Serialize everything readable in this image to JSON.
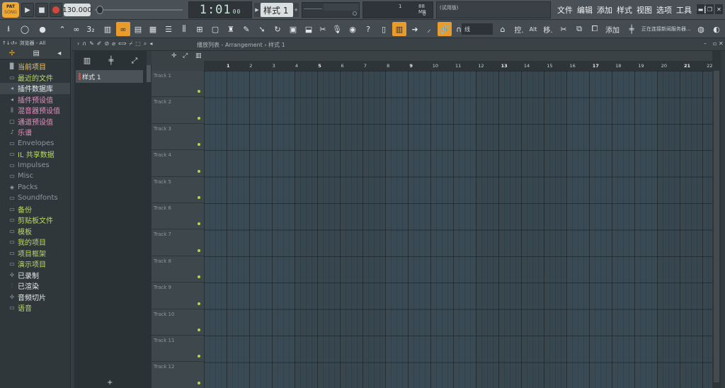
{
  "topbar": {
    "pat_label": "PAT",
    "song_label": "SONG",
    "tempo": "130.000",
    "time": "1:01",
    "time_sub": "00",
    "pattern": "样式 1",
    "cpu_value": "1",
    "ram_value": "88 MB",
    "poly_value": "0",
    "hint_text": "(试用版)"
  },
  "menu": [
    "文件",
    "编辑",
    "添加",
    "样式",
    "视图",
    "选项",
    "工具",
    "帮助"
  ],
  "toolbar": {
    "snap": "线",
    "controls_label": "控.",
    "alt_label": "Alt",
    "move_label": "移.",
    "add_label": "添加",
    "news_text": "正在连接新闻服务器..."
  },
  "browser": {
    "header": "浏览器 - All",
    "items": [
      {
        "label": "当前项目",
        "icon": "document-icon",
        "color": "#f2c45a"
      },
      {
        "label": "最近的文件",
        "icon": "folder-icon",
        "color": "#b8dc5a"
      },
      {
        "label": "插件数据库",
        "icon": "plugin-icon",
        "color": "#e8ecee"
      },
      {
        "label": "插件预设值",
        "icon": "plugin-preset-icon",
        "color": "#e88cc2"
      },
      {
        "label": "混音器预设值",
        "icon": "mixer-icon",
        "color": "#e88cc2"
      },
      {
        "label": "通道预设值",
        "icon": "channel-icon",
        "color": "#e88cc2"
      },
      {
        "label": "乐谱",
        "icon": "note-icon",
        "color": "#e88cc2"
      },
      {
        "label": "Envelopes",
        "icon": "folder-icon",
        "color": "#8d979c"
      },
      {
        "label": "IL 共享数据",
        "icon": "folder-icon",
        "color": "#b8dc5a"
      },
      {
        "label": "Impulses",
        "icon": "folder-icon",
        "color": "#8d979c"
      },
      {
        "label": "Misc",
        "icon": "folder-icon",
        "color": "#8d979c"
      },
      {
        "label": "Packs",
        "icon": "packs-icon",
        "color": "#8d979c"
      },
      {
        "label": "Soundfonts",
        "icon": "folder-icon",
        "color": "#8d979c"
      },
      {
        "label": "备份",
        "icon": "folder-icon",
        "color": "#b8dc5a"
      },
      {
        "label": "剪贴板文件",
        "icon": "folder-icon",
        "color": "#b8dc5a"
      },
      {
        "label": "模板",
        "icon": "folder-icon",
        "color": "#b8dc5a"
      },
      {
        "label": "我的项目",
        "icon": "folder-icon",
        "color": "#b8dc5a"
      },
      {
        "label": "项目框架",
        "icon": "folder-icon",
        "color": "#b8dc5a"
      },
      {
        "label": "演示项目",
        "icon": "folder-icon",
        "color": "#b8dc5a"
      },
      {
        "label": "已录制",
        "icon": "recorded-icon",
        "color": "#e8ecee"
      },
      {
        "label": "已渲染",
        "icon": "rendered-icon",
        "color": "#e8ecee"
      },
      {
        "label": "音频切片",
        "icon": "slice-icon",
        "color": "#e8ecee"
      },
      {
        "label": "语音",
        "icon": "folder-icon",
        "color": "#b8dc5a"
      }
    ]
  },
  "playlist": {
    "title": "播放列表 - Arrangement › 样式 1",
    "pattern_item": "样式 1",
    "tracks": [
      "Track 1",
      "Track 2",
      "Track 3",
      "Track 4",
      "Track 5",
      "Track 6",
      "Track 7",
      "Track 8",
      "Track 9",
      "Track 10",
      "Track 11",
      "Track 12"
    ],
    "ruler": [
      "1",
      "2",
      "3",
      "4",
      "5",
      "6",
      "7",
      "8",
      "9",
      "10",
      "11",
      "12",
      "13",
      "14",
      "15",
      "16",
      "17",
      "18",
      "19",
      "20",
      "21",
      "22",
      "23"
    ]
  }
}
